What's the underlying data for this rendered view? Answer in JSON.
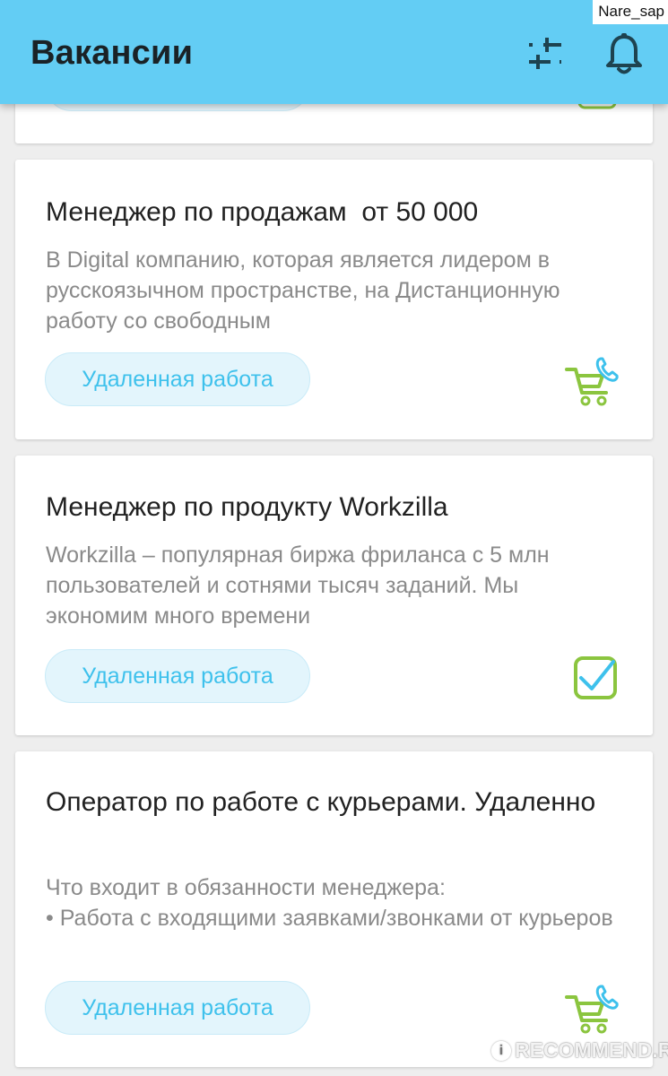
{
  "status": {
    "user": "Nare_sap"
  },
  "header": {
    "title": "Вакансии",
    "filter_icon": "sliders-icon",
    "notifications_icon": "bell-icon"
  },
  "jobs": [
    {
      "title": "Менеджер по продажам  от 50 000",
      "description": "В Digital компанию, которая является лидером в русскоязычном пространстве, на Дистанционную работу со свободным",
      "tag": "Удаленная работа",
      "icon": "cart-phone-icon"
    },
    {
      "title": "Менеджер по продукту Workzilla",
      "description": "Workzilla – популярная биржа фриланса с 5 млн пользователей и сотнями тысяч заданий. Мы экономим много времени",
      "tag": "Удаленная работа",
      "icon": "checkbox-checked-icon"
    },
    {
      "title": "Оператор по работе с курьерами. Удаленно",
      "description": "Что входит в обязанности менеджера:\n• Работа с входящими заявками/звонками от курьеров",
      "tag": "Удаленная работа",
      "icon": "cart-phone-icon"
    }
  ],
  "watermark": {
    "text": "RECOMMEND.RU",
    "badge": "i"
  },
  "colors": {
    "header_bg": "#63cdf4",
    "tag_bg": "#e3f5fc",
    "tag_text": "#3ec1ec",
    "icon_green": "#8bc53f",
    "icon_blue": "#3ec1ec"
  }
}
